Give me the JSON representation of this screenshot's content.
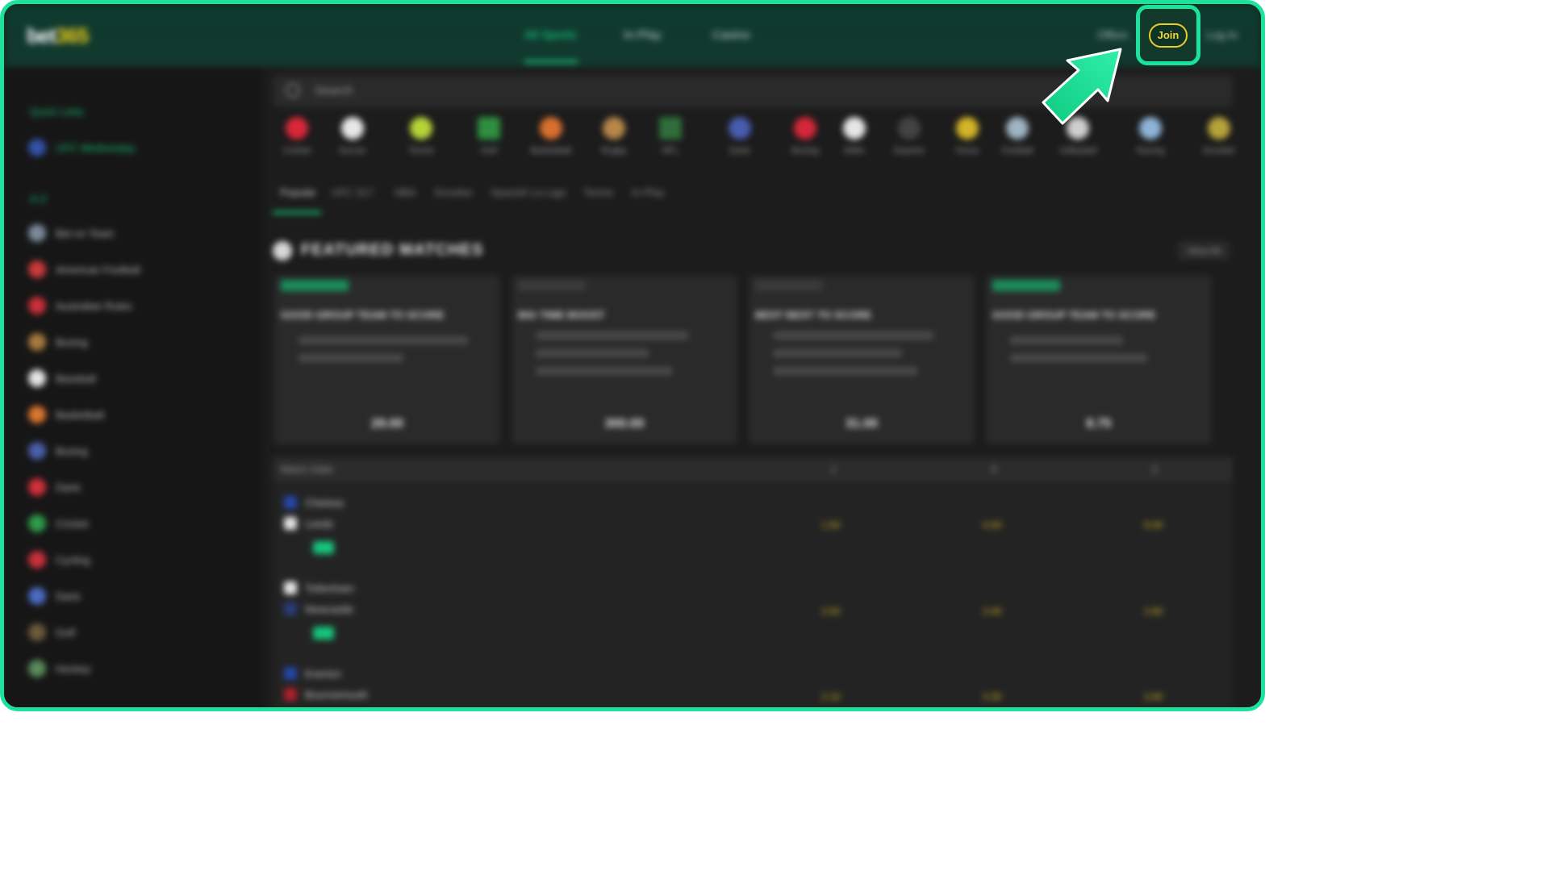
{
  "header": {
    "logo_main": "bet",
    "logo_accent": "365",
    "nav": [
      "All Sports",
      "In-Play",
      "Casino"
    ],
    "links": [
      "Offers",
      "Log In"
    ],
    "join_label": "Join"
  },
  "sidebar": {
    "sections": [
      {
        "heading": "Quick Links",
        "items": [
          "UFC Wednesday"
        ]
      },
      {
        "heading": "A-Z",
        "items": [
          "Bet on Team",
          "American Football",
          "Australian Rules",
          "Boxing",
          "Baseball",
          "Basketball",
          "Boxing",
          "Darts",
          "Cricket",
          "Cycling",
          "Darts",
          "Golf",
          "Hockey"
        ]
      }
    ]
  },
  "search": {
    "placeholder": "Search"
  },
  "sports": [
    "Cricket",
    "Soccer",
    "Tennis",
    "Golf",
    "Basketball",
    "Rugby",
    "NFL",
    "Darts",
    "Boxing",
    "MMA",
    "Esports",
    "Horse",
    "Football",
    "Volleyball",
    "Racing",
    "Snooker"
  ],
  "subtabs": [
    "Popular",
    "UFC 317",
    "NBA",
    "Snooker",
    "Spanish La Liga",
    "Tennis",
    "In-Play"
  ],
  "featured": {
    "title": "FEATURED MATCHES",
    "view_all": "View All",
    "cards": [
      {
        "title": "GOOD GROUP TEAM TO SCORE",
        "odds": "29.00"
      },
      {
        "title": "BIG TIME BOOST",
        "odds": "300.00"
      },
      {
        "title": "BEST BEST TO SCORE",
        "odds": "31.00"
      },
      {
        "title": "GOOD GROUP TEAM TO SCORE",
        "odds": "8.75"
      }
    ]
  },
  "table": {
    "label": "Match Odds",
    "cols": [
      "1",
      "X",
      "2"
    ],
    "rows": [
      {
        "home": "Chelsea",
        "away": "Leeds",
        "odds": [
          "1.50",
          "4.50",
          "6.00"
        ]
      },
      {
        "home": "Tottenham",
        "away": "Newcastle",
        "odds": [
          "2.50",
          "3.40",
          "2.80"
        ]
      },
      {
        "home": "Everton",
        "away": "Bournemouth",
        "odds": [
          "2.10",
          "3.30",
          "3.60"
        ]
      }
    ]
  },
  "colors": {
    "accent": "#1be39b",
    "join": "#e9ce23",
    "brand_green": "#12382d"
  }
}
